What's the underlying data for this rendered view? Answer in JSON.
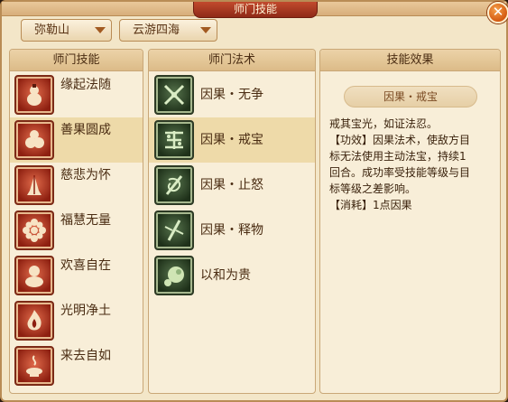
{
  "window": {
    "title": "师门技能",
    "close_label": "✕"
  },
  "filters": {
    "school": "弥勒山",
    "mode": "云游四海"
  },
  "skills_panel": {
    "header": "师门技能",
    "items": [
      {
        "label": "缘起法随",
        "icon": "gourd-icon"
      },
      {
        "label": "善果圆成",
        "icon": "peaches-icon"
      },
      {
        "label": "慈悲为怀",
        "icon": "praying-hands-icon"
      },
      {
        "label": "福慧无量",
        "icon": "lotus-flower-icon"
      },
      {
        "label": "欢喜自在",
        "icon": "laughing-buddha-icon"
      },
      {
        "label": "光明净土",
        "icon": "flame-icon"
      },
      {
        "label": "来去自如",
        "icon": "incense-icon"
      }
    ],
    "selected_index": 1
  },
  "spells_panel": {
    "header": "师门法术",
    "items": [
      {
        "label": "因果・无争",
        "icon": "crossed-swords-icon"
      },
      {
        "label": "因果・戒宝",
        "icon": "treasure-seal-icon"
      },
      {
        "label": "因果・止怒",
        "icon": "sword-vortex-icon"
      },
      {
        "label": "因果・释物",
        "icon": "released-sword-icon"
      },
      {
        "label": "以和为贵",
        "icon": "gourd-orb-icon"
      }
    ],
    "selected_index": 1
  },
  "effect_panel": {
    "header": "技能效果",
    "name": "因果・戒宝",
    "lines": [
      "戒其宝光，如证法忍。",
      "【功效】因果法术，使敌方目",
      "标无法使用主动法宝，持续1",
      "回合。成功率受技能等级与目",
      "标等级之差影响。",
      "【消耗】1点因果"
    ]
  }
}
